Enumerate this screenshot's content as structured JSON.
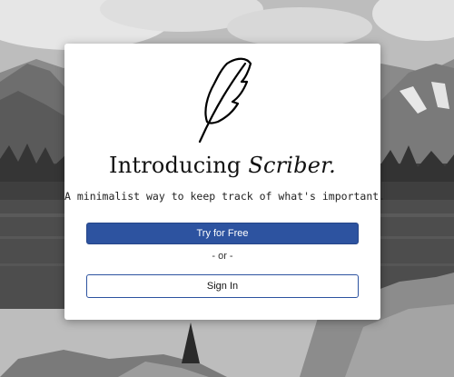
{
  "background": {
    "description_icon": "mountain-lake-photo"
  },
  "card": {
    "logo_icon": "feather-quill-icon",
    "title_prefix": "Introducing ",
    "title_brand": "Scriber.",
    "tagline": "A minimalist way to keep track of what's important.",
    "primary_button": "Try for Free",
    "divider_text": "- or -",
    "secondary_button": "Sign In"
  },
  "colors": {
    "accent": "#2d53a0",
    "card_bg": "#ffffff"
  }
}
